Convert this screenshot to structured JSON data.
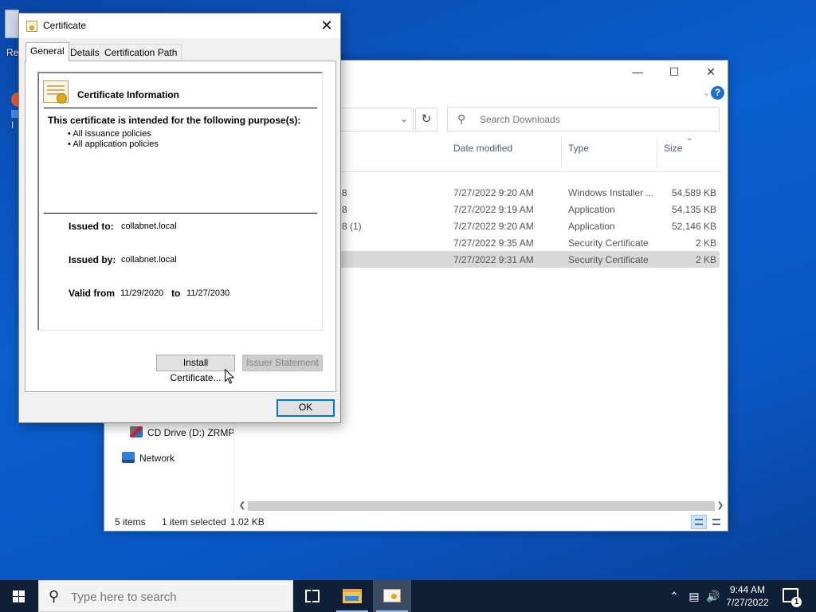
{
  "desktop": {
    "icons": [
      {
        "label": "Re"
      },
      {
        "label": "I"
      }
    ]
  },
  "explorer": {
    "caption_buttons": {
      "minimize": "—",
      "maximize": "☐",
      "close": "✕"
    },
    "help_label": "?",
    "search": {
      "placeholder": "Search Downloads"
    },
    "columns": {
      "date": "Date modified",
      "type": "Type",
      "size": "Size"
    },
    "rows": [
      {
        "name": "8",
        "date": "7/27/2022 9:20 AM",
        "type": "Windows Installer ...",
        "size": "54,589 KB",
        "selected": false
      },
      {
        "name": "8",
        "date": "7/27/2022 9:19 AM",
        "type": "Application",
        "size": "54,135 KB",
        "selected": false
      },
      {
        "name": "8 (1)",
        "date": "7/27/2022 9:20 AM",
        "type": "Application",
        "size": "52,146 KB",
        "selected": false
      },
      {
        "name": "",
        "date": "7/27/2022 9:35 AM",
        "type": "Security Certificate",
        "size": "2 KB",
        "selected": false
      },
      {
        "name": "",
        "date": "7/27/2022 9:31 AM",
        "type": "Security Certificate",
        "size": "2 KB",
        "selected": true
      }
    ],
    "nav": {
      "cd_drive": "CD Drive (D:) ZRMP",
      "network": "Network"
    },
    "status": {
      "items": "5 items",
      "selected": "1 item selected",
      "size": "1.02 KB"
    }
  },
  "dialog": {
    "title": "Certificate",
    "close": "✕",
    "tabs": [
      {
        "label": "General",
        "active": true
      },
      {
        "label": "Details",
        "active": false
      },
      {
        "label": "Certification Path",
        "active": false
      }
    ],
    "info_title": "Certificate Information",
    "purpose_heading": "This certificate is intended for the following purpose(s):",
    "purposes": [
      "All issuance policies",
      "All application policies"
    ],
    "issued_to_label": "Issued to:",
    "issued_to": "collabnet.local",
    "issued_by_label": "Issued by:",
    "issued_by": "collabnet.local",
    "valid_from_label": "Valid from",
    "valid_from": "11/29/2020",
    "valid_to_label": "to",
    "valid_to": "11/27/2030",
    "install_button": "Install Certificate...",
    "issuer_statement_button": "Issuer Statement",
    "ok_button": "OK"
  },
  "taskbar": {
    "search_placeholder": "Type here to search",
    "clock_time": "9:44 AM",
    "clock_date": "7/27/2022",
    "notification_count": "1",
    "tray_chevron": "^"
  }
}
